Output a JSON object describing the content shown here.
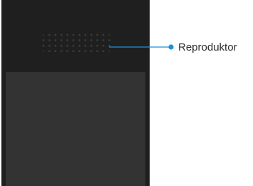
{
  "callout": {
    "label": "Reproduktor",
    "color": "#1e90d6"
  }
}
